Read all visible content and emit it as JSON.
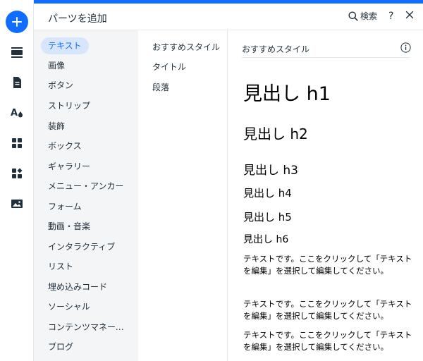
{
  "panel": {
    "title": "パーツを追加"
  },
  "header": {
    "search_label": "検索",
    "help_label": "?"
  },
  "categories": [
    "テキスト",
    "画像",
    "ボタン",
    "ストリップ",
    "装飾",
    "ボックス",
    "ギャラリー",
    "メニュー・アンカー",
    "フォーム",
    "動画・音楽",
    "インタラクティブ",
    "リスト",
    "埋め込みコード",
    "ソーシャル",
    "コンテンツマネージャー",
    "ブログ"
  ],
  "subcategories": [
    "おすすめスタイル",
    "タイトル",
    "段落"
  ],
  "preview": {
    "title": "おすすめスタイル",
    "headings": [
      "見出し h1",
      "見出し h2",
      "見出し h3",
      "見出し h4",
      "見出し h5",
      "見出し h6"
    ],
    "paragraphs": [
      "テキストです。ここをクリックして「テキストを編集」を選択して編集してください。",
      "テキストです。ここをクリックして「テキストを編集」を選択して編集してください。",
      "テキストです。ここをクリックして「テキストを編集」を選択して編集してください。"
    ]
  },
  "colors": {
    "accent": "#116dff",
    "active_bg": "#d7e5fd",
    "sidebar_bg": "#f4f5f7"
  }
}
